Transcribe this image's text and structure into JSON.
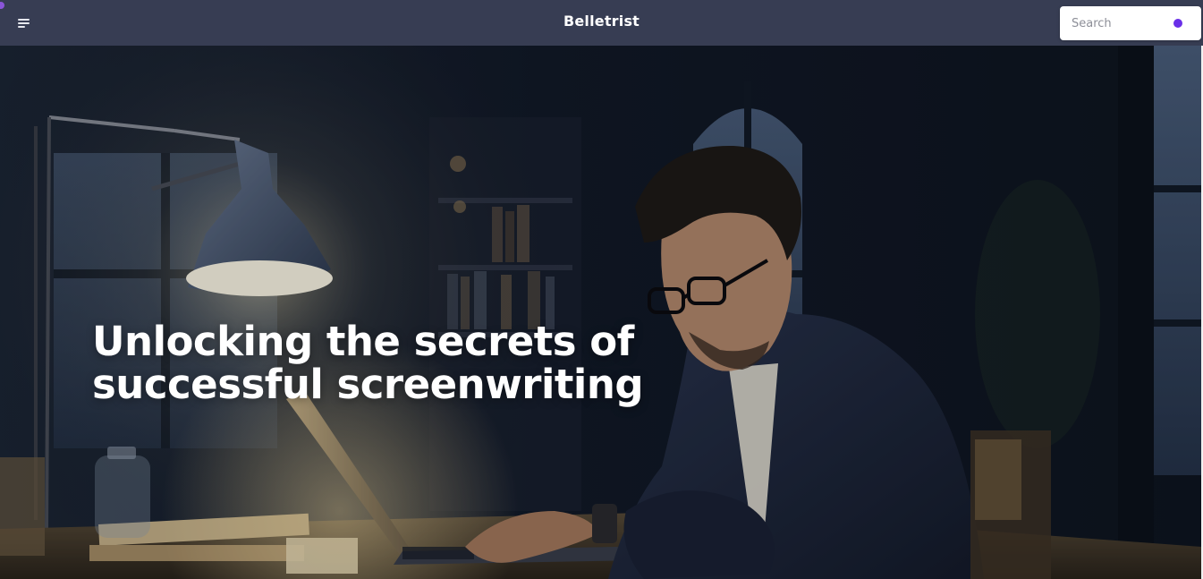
{
  "header": {
    "brand": "Belletrist",
    "menu_icon": "hamburger-menu-icon",
    "background_color": "#373d53",
    "search": {
      "placeholder": "Search",
      "value": "",
      "accent_color": "#6a2fe8"
    }
  },
  "hero": {
    "headline_line1": "Unlocking the secrets of",
    "headline_line2": "successful screenwriting",
    "image_subject": "man in glasses typing on a laptop under a desk lamp at night"
  }
}
